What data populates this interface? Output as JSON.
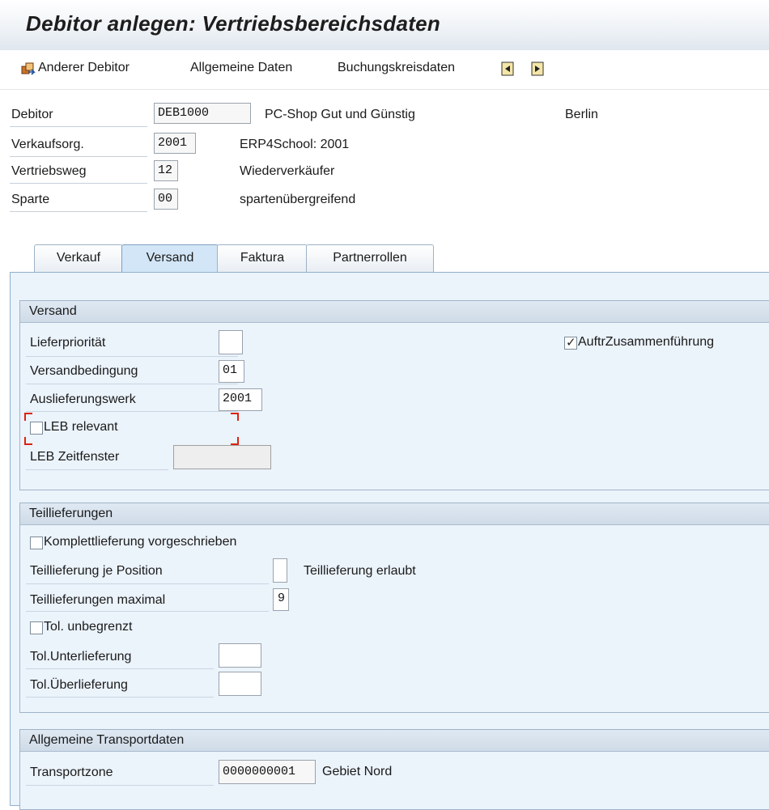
{
  "window": {
    "title": "Debitor anlegen: Vertriebsbereichsdaten"
  },
  "toolbar": {
    "other_debitor": "Anderer Debitor",
    "general_data": "Allgemeine Daten",
    "company_code_data": "Buchungskreisdaten",
    "icons": [
      "other-debitor-icon",
      "previous-screen-icon",
      "next-screen-icon"
    ]
  },
  "header": {
    "debitor": {
      "label": "Debitor",
      "value": "DEB1000",
      "name": "PC-Shop Gut und Günstig",
      "city": "Berlin"
    },
    "sales_org": {
      "label": "Verkaufsorg.",
      "value": "2001",
      "desc": "ERP4School: 2001"
    },
    "channel": {
      "label": "Vertriebsweg",
      "value": "12",
      "desc": "Wiederverkäufer"
    },
    "division": {
      "label": "Sparte",
      "value": "00",
      "desc": "spartenübergreifend"
    }
  },
  "tabs": [
    {
      "label": "Verkauf",
      "active": false
    },
    {
      "label": "Versand",
      "active": true
    },
    {
      "label": "Faktura",
      "active": false
    },
    {
      "label": "Partnerrollen",
      "active": false
    }
  ],
  "versand": {
    "title": "Versand",
    "priority": {
      "label": "Lieferpriorität",
      "value": ""
    },
    "combine": {
      "label": "AuftrZusammenführung",
      "checked": true
    },
    "shipping_cond": {
      "label": "Versandbedingung",
      "value": "01"
    },
    "plant": {
      "label": "Auslieferungswerk",
      "value": "2001"
    },
    "pod_relevant": {
      "label": "LEB relevant",
      "checked": false
    },
    "pod_window": {
      "label": "LEB Zeitfenster",
      "value": ""
    }
  },
  "teillieferungen": {
    "title": "Teillieferungen",
    "complete": {
      "label": "Komplettlieferung vorgeschrieben",
      "checked": false
    },
    "per_item": {
      "label": "Teillieferung je Position",
      "value": "",
      "desc": "Teillieferung erlaubt"
    },
    "max": {
      "label": "Teillieferungen maximal",
      "value": "9"
    },
    "unlimited": {
      "label": "Tol. unbegrenzt",
      "checked": false
    },
    "under": {
      "label": "Tol.Unterlieferung",
      "value": ""
    },
    "over": {
      "label": "Tol.Überlieferung",
      "value": ""
    }
  },
  "transport": {
    "title": "Allgemeine Transportdaten",
    "zone": {
      "label": "Transportzone",
      "value": "0000000001",
      "desc": "Gebiet Nord"
    }
  }
}
